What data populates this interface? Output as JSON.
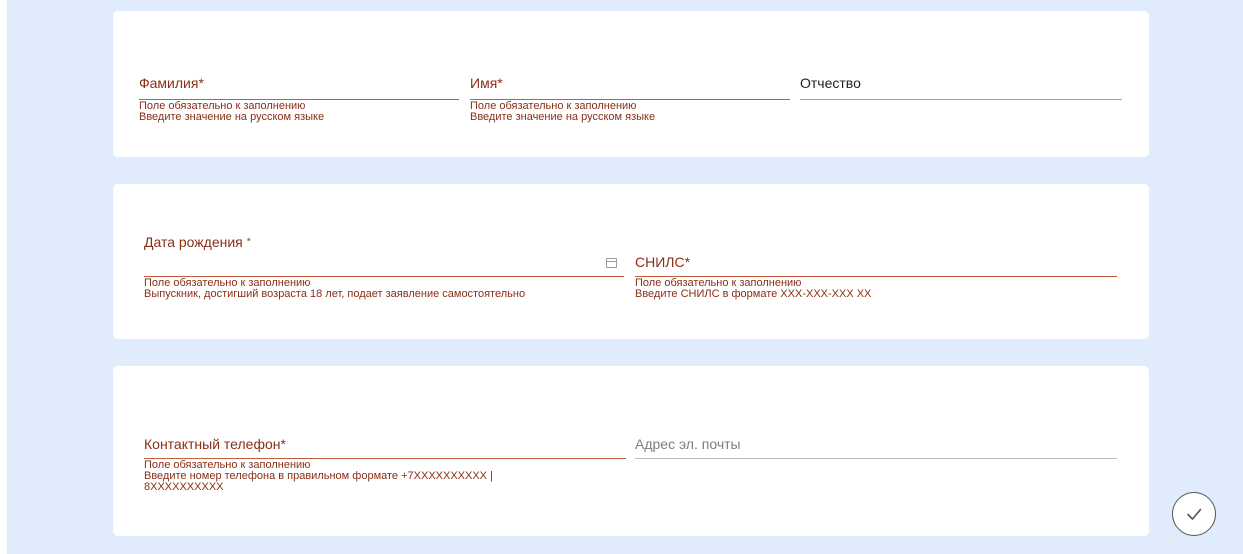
{
  "section_name": {
    "last_name": {
      "label": "Фамилия*",
      "errors": [
        "Поле обязательно к заполнению",
        "Введите значение на русском языке"
      ]
    },
    "first_name": {
      "label": "Имя*",
      "errors": [
        "Поле обязательно к заполнению",
        "Введите значение на русском языке"
      ]
    },
    "middle_name": {
      "label": "Отчество"
    }
  },
  "section_identity": {
    "birth_date": {
      "label": "Дата рождения",
      "required_mark": "*",
      "errors": [
        "Поле обязательно к заполнению",
        "Выпускник, достигший возраста 18 лет, подает заявление самостоятельно"
      ]
    },
    "snils": {
      "label": "СНИЛС*",
      "errors": [
        "Поле обязательно к заполнению",
        "Введите СНИЛС в формате XXX-XXX-XXX XX"
      ]
    }
  },
  "section_contacts": {
    "phone": {
      "label": "Контактный телефон*",
      "errors": [
        "Поле обязательно к заполнению",
        "Введите номер телефона в правильном формате +7XXXXXXXXXX |",
        "8XXXXXXXXXX"
      ]
    },
    "email": {
      "label": "Адрес эл. почты"
    }
  },
  "icons": {
    "calendar": "calendar-icon",
    "submit": "check-circle-icon"
  },
  "colors": {
    "page_background": "#e0ecfb",
    "error_text": "#8a2e16",
    "error_line": "#c0603e",
    "focus_line": "#7da7dc"
  }
}
